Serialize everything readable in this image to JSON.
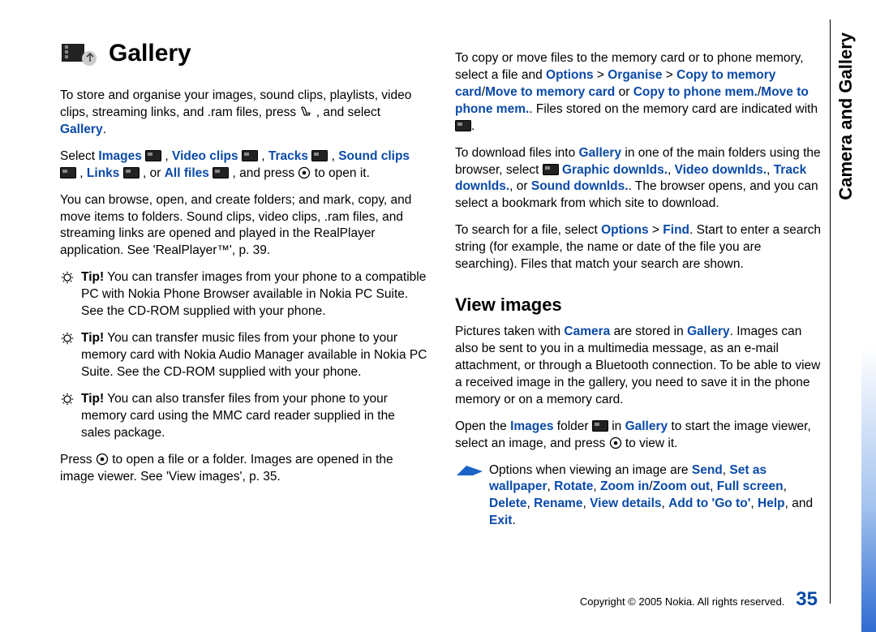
{
  "side_tab": "Camera and Gallery",
  "title": "Gallery",
  "subhead_view_images": "View images",
  "footer": {
    "copyright": "Copyright © 2005 Nokia. All rights reserved.",
    "page": "35"
  },
  "col1": {
    "p1": {
      "t1": "To store and organise your images, sound clips, playlists, video clips, streaming links, and .ram files, press ",
      "t2": " , and select ",
      "gallery": "Gallery",
      "t3": "."
    },
    "p2": {
      "t1": "Select ",
      "images": "Images",
      "sep1": " , ",
      "video": "Video clips",
      "sep2": " , ",
      "tracks": "Tracks",
      "sep3": " , ",
      "sound": "Sound clips",
      "sep4": " , ",
      "links": "Links",
      "sep5": " , or ",
      "all": "All files",
      "sep6": " , and press ",
      "t2": " to open it."
    },
    "p3": "You can browse, open, and create folders; and mark, copy, and move items to folders. Sound clips, video clips, .ram files, and streaming links are opened and played in the RealPlayer application. See 'RealPlayer™', p. 39.",
    "tip1_b": "Tip!",
    "tip1": " You can transfer images from your phone to a compatible PC with Nokia Phone Browser available in Nokia PC Suite. See the CD-ROM supplied with your phone.",
    "tip2_b": "Tip!",
    "tip2": " You can transfer music files from your phone to your memory card with Nokia Audio Manager available in Nokia PC Suite. See the CD-ROM supplied with your phone.",
    "tip3_b": "Tip!",
    "tip3": " You can also transfer files from your phone to your memory card using the MMC card reader supplied in the sales package.",
    "p4": {
      "t1": "Press ",
      "t2": " to open a file or a folder. Images are opened in the image viewer. See 'View images', p. 35."
    }
  },
  "col2": {
    "p1": {
      "t1": "To copy or move files to the memory card or to phone memory, select a file and ",
      "options": "Options",
      "gt1": " > ",
      "organise": "Organise",
      "gt2": " > ",
      "copy_card": "Copy to memory card",
      "slash1": "/",
      "move_card": "Move to memory card",
      "or1": " or ",
      "copy_mem": "Copy to phone mem.",
      "slash2": "/",
      "move_mem": "Move to phone mem.",
      "t2": ". Files stored on the memory card are indicated with ",
      "t3": "."
    },
    "p2": {
      "t1": "To download files into ",
      "gallery": "Gallery",
      "t2": " in one of the main folders using the browser, select ",
      "graphic": "Graphic downlds.",
      "sep1": ", ",
      "video": "Video downlds.",
      "sep2": ", ",
      "track": "Track downlds.",
      "sep3": ", or ",
      "sound": "Sound downlds.",
      "t3": ". The browser opens, and you can select a bookmark from which site to download."
    },
    "p3": {
      "t1": "To search for a file, select ",
      "options": "Options",
      "gt": " > ",
      "find": "Find",
      "t2": ". Start to enter a search string (for example, the name or date of the file you are searching). Files that match your search are shown."
    },
    "v1": {
      "t1": "Pictures taken with ",
      "camera": "Camera",
      "t2": " are stored in ",
      "gallery": "Gallery",
      "t3": ". Images can also be sent to you in a multimedia message, as an e-mail attachment, or through a Bluetooth connection. To be able to view a received image in the gallery, you need to save it in the phone memory or on a memory card."
    },
    "v2": {
      "t1": "Open the ",
      "images": "Images",
      "t2": " folder ",
      "t3": " in ",
      "gallery": "Gallery",
      "t4": " to start the image viewer, select an image, and press ",
      "t5": " to view it."
    },
    "opt": {
      "t1": "Options when viewing an image are ",
      "send": "Send",
      "c1": ", ",
      "setwp": "Set as wallpaper",
      "c2": ", ",
      "rotate": "Rotate",
      "c3": ", ",
      "zin": "Zoom in",
      "slash": "/",
      "zout": "Zoom out",
      "c4": ", ",
      "full": "Full screen",
      "c5": ", ",
      "del": "Delete",
      "c6": ", ",
      "ren": "Rename",
      "c7": ", ",
      "vd": "View details",
      "c8": ", ",
      "goto": "Add to 'Go to'",
      "c9": ", ",
      "help": "Help",
      "c10": ", and ",
      "exit": "Exit",
      "dot": "."
    }
  }
}
